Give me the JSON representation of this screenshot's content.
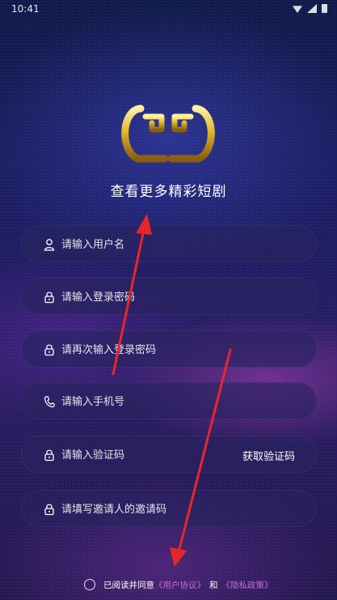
{
  "status_bar": {
    "time": "10:41"
  },
  "tagline": "查看更多精彩短剧",
  "fields": {
    "username": {
      "placeholder": "请输入用户名",
      "icon": "user-icon"
    },
    "password": {
      "placeholder": "请输入登录密码",
      "icon": "lock-icon"
    },
    "password_confirm": {
      "placeholder": "请再次输入登录密码",
      "icon": "lock-icon"
    },
    "phone": {
      "placeholder": "请输入手机号",
      "icon": "phone-icon"
    },
    "code": {
      "placeholder": "请输入验证码",
      "icon": "lock-icon",
      "action_label": "获取验证码"
    },
    "invite": {
      "placeholder": "请填写邀请人的邀请码",
      "icon": "lock-icon"
    }
  },
  "agreement": {
    "prefix": "已阅读并同意",
    "user_agreement": "《用户协议》",
    "connector": "和",
    "privacy_policy": "《隐私政策》"
  },
  "colors": {
    "accent_link": "#c46ad8",
    "annotation_arrow": "#e8262a",
    "logo_gold": "#e3b72d"
  }
}
